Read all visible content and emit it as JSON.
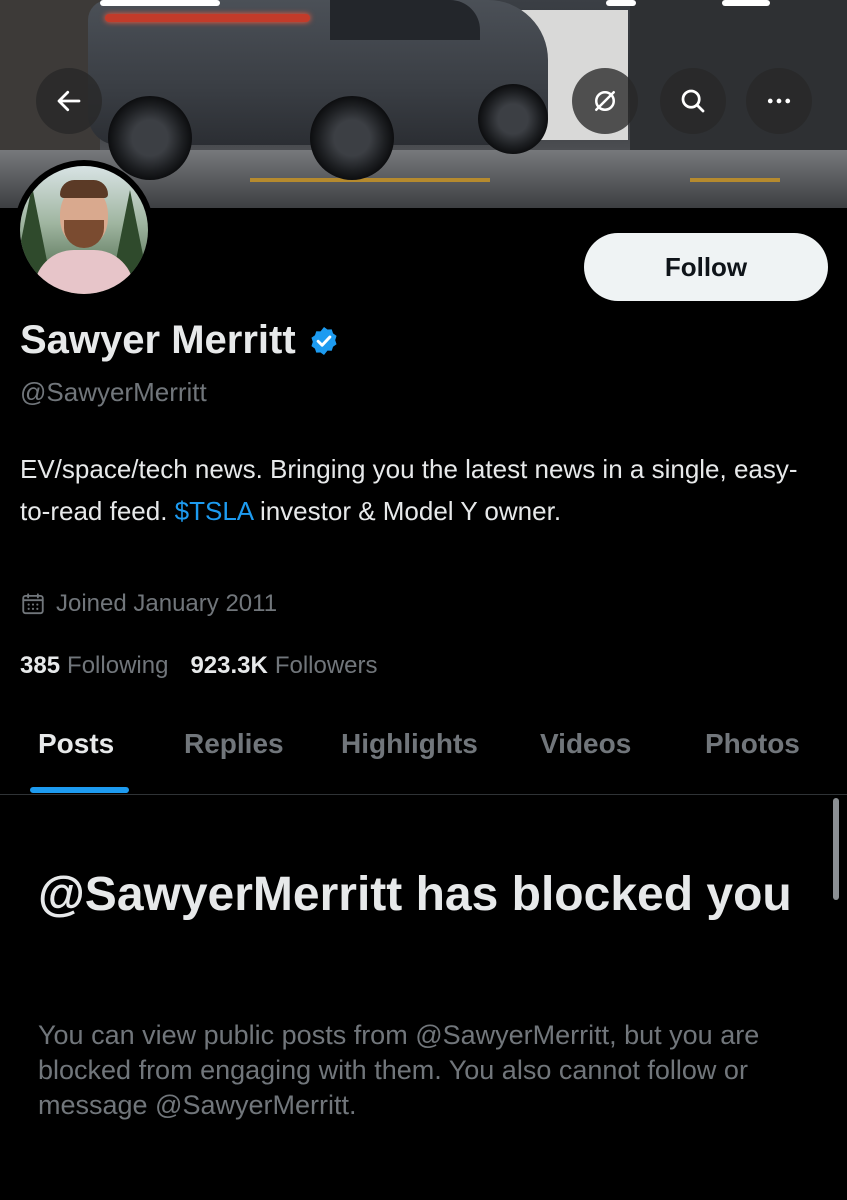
{
  "banner": {
    "back_icon": "arrow-left-icon",
    "grok_icon": "slashed-circle-icon",
    "search_icon": "search-icon",
    "more_icon": "more-horizontal-icon"
  },
  "profile": {
    "display_name": "Sawyer Merritt",
    "verified_icon": "verified-badge-icon",
    "handle": "@SawyerMerritt",
    "bio_part1": "EV/space/tech news. Bringing you the latest news in a single, easy-to-read feed. ",
    "bio_cashtag": "$TSLA",
    "bio_part2": " investor & Model Y owner.",
    "joined": "Joined January 2011",
    "following_count": "385",
    "following_label": "Following",
    "followers_count": "923.3K",
    "followers_label": "Followers"
  },
  "actions": {
    "follow_label": "Follow"
  },
  "tabs": [
    {
      "label": "Posts",
      "active": true
    },
    {
      "label": "Replies",
      "active": false
    },
    {
      "label": "Highlights",
      "active": false
    },
    {
      "label": "Videos",
      "active": false
    },
    {
      "label": "Photos",
      "active": false
    }
  ],
  "blocked": {
    "title": "@SawyerMerritt has blocked you",
    "body": "You can view public posts from @SawyerMerritt, but you are blocked from engaging with them. You also cannot follow or message @SawyerMerritt."
  },
  "colors": {
    "accent": "#1d9bf0",
    "background": "#000000",
    "primary_text": "#e7e9ea",
    "secondary_text": "#71767b"
  }
}
